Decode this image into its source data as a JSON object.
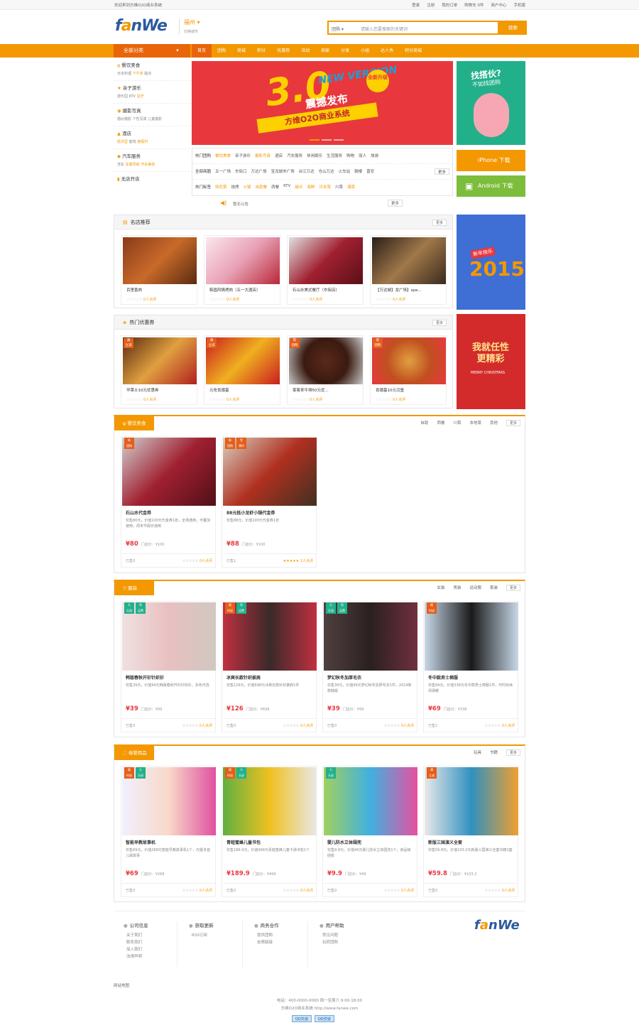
{
  "topbar": {
    "welcome": "欢迎来到方维O2O商业系统",
    "links": [
      "登录",
      "注册",
      "我的订单",
      "购物车 0件",
      "商户中心",
      "手机版"
    ]
  },
  "header": {
    "logo_text": "fanWe",
    "city": "福州",
    "city_switch": "切换城市",
    "search_select": "团购",
    "search_placeholder": "请输入您要搜索的关键词",
    "search_button": "搜索"
  },
  "nav": {
    "all_label": "全部分类",
    "items": [
      "首页",
      "团购",
      "商城",
      "积分",
      "优惠券",
      "活动",
      "商家",
      "分享",
      "小组",
      "达人秀",
      "积分商城"
    ]
  },
  "categories": [
    {
      "title": "餐饮美食",
      "subs": [
        "日本料理",
        "下午茶",
        "甜点"
      ]
    },
    {
      "title": "亲子游乐",
      "subs": [
        "游乐园",
        "KTV",
        "足疗"
      ]
    },
    {
      "title": "摄影写真",
      "subs": [
        "婚纱摄影",
        "个性写真",
        "儿童摄影"
      ]
    },
    {
      "title": "酒店",
      "subs": [
        "经济型",
        "客栈",
        "度假村"
      ]
    },
    {
      "title": "汽车服务",
      "subs": [
        "洗车",
        "车载导航",
        "汽车美容"
      ]
    },
    {
      "title": "无店开店",
      "subs": []
    }
  ],
  "banner": {
    "big": "3.0",
    "new": "NEW VERSION",
    "badge": "全新升级",
    "headline": "震撼发布",
    "ribbon": "方维O2O商业系统"
  },
  "side_ad": {
    "line1": "找搭伙?",
    "line2": "不如找团购"
  },
  "apps": {
    "ios": "iPhone 下载",
    "android": "Android 下载"
  },
  "hot": {
    "row1": [
      "热门团购",
      "餐饮美食",
      "亲子游乐",
      "摄影写真",
      "酒店",
      "汽车服务",
      "休闲娱乐",
      "生活服务",
      "购物",
      "丽人",
      "旅游"
    ],
    "row2": [
      "全部商圈",
      "五一广场",
      "东街口",
      "万达广场",
      "宝龙城市广场",
      "台江万达",
      "仓山万达",
      "火车站",
      "鼓楼",
      "晋安"
    ],
    "row3": [
      "热门标签",
      "特色菜",
      "烧烤",
      "火锅",
      "自助餐",
      "西餐",
      "KTV",
      "甜点",
      "海鲜",
      "日本菜",
      "川菜",
      "湘菜"
    ],
    "more": "更多"
  },
  "notice": {
    "text": "暂无公告",
    "more": "更多"
  },
  "stores": {
    "title": "名店推荐",
    "more": "更多",
    "items": [
      {
        "name": "百里香肉",
        "count": "0人点评"
      },
      {
        "name": "韩国风情烤肉（五一大酒店）",
        "count": "0人点评"
      },
      {
        "name": "石山水美式餐厅（东街店）",
        "count": "0人点评"
      },
      {
        "name": "【万达城】龙广场】spa...",
        "count": "0人点评"
      }
    ]
  },
  "coupons": {
    "title": "热门优惠券",
    "more": "更多",
    "items": [
      {
        "name": "华莱士10元优惠券",
        "count": "0人点评"
      },
      {
        "name": "元吃肯德基",
        "count": "0人点评"
      },
      {
        "name": "豪客来牛排50元优...",
        "count": "0人点评"
      },
      {
        "name": "肯德基10元汉堡",
        "count": "0人点评"
      }
    ]
  },
  "promo2": {
    "text": "2015",
    "tag": "新年快乐"
  },
  "promo3": {
    "text": "我就任性 更精彩",
    "tag": "MERRY CHRISTMAS"
  },
  "sections": [
    {
      "title": "餐饮美食",
      "subs": [
        "自助",
        "西餐",
        "川菜",
        "本地菜",
        "其他"
      ],
      "more": "更多",
      "deals": [
        {
          "name": "石山水代金券",
          "desc": "仅售80元，价值100元代金券1张，全场通用，可叠加使用，周末节假日通用",
          "price": "¥80",
          "orig": "门店价：¥100",
          "sold": "已售0",
          "rate": "0人点评"
        },
        {
          "name": "88元抵小龙虾小锅代金券",
          "desc": "仅售88元，价值100元代金券1张",
          "price": "¥88",
          "orig": "门店价：¥100",
          "sold": "已售1",
          "rate": "1人点评"
        }
      ]
    },
    {
      "title": "服装",
      "subs": [
        "女装",
        "男装",
        "运动服",
        "套装"
      ],
      "more": "更多",
      "deals": [
        {
          "name": "韩版春秋开衫针织衫",
          "desc": "仅售39元，价值99元韩版春秋开衫针织衫，多色可选",
          "price": "¥39",
          "orig": "门店价：¥99",
          "sold": "已售0",
          "rate": "0人点评"
        },
        {
          "name": "冰爽长款针织披肩",
          "desc": "仅售126元，价值698元冰爽长款针织披肩1件",
          "price": "¥126",
          "orig": "门店价：¥698",
          "sold": "已售0",
          "rate": "0人点评"
        },
        {
          "name": "梦幻秋冬加厚毛衣",
          "desc": "仅售39元，价值99元梦幻秋冬加厚毛衣1件，2014新款韩版",
          "price": "¥39",
          "orig": "门店价：¥99",
          "sold": "已售0",
          "rate": "0人点评"
        },
        {
          "name": "冬中款男士棉服",
          "desc": "仅售69元，价值338元冬中款男士棉服1件，可时尚休闲保暖",
          "price": "¥69",
          "orig": "门店价：¥338",
          "sold": "已售1",
          "rate": "0人点评"
        }
      ]
    },
    {
      "title": "母婴用品",
      "subs": [
        "玩具",
        "书籍"
      ],
      "more": "更多",
      "deals": [
        {
          "name": "智能早教故事机",
          "desc": "仅售69元，价值268元智能早教故事机1个，内置多首儿歌故事",
          "price": "¥69",
          "orig": "门店价：¥268",
          "sold": "已售0",
          "rate": "0人点评"
        },
        {
          "name": "青蛙蜜蜂儿童书包",
          "desc": "仅售189.9元，价值499元青蛙蜜蜂儿童卡通书包1个",
          "price": "¥189.9",
          "orig": "门店价：¥499",
          "sold": "已售0",
          "rate": "0人点评"
        },
        {
          "name": "婴儿防水立体围兜",
          "desc": "仅售9.9元，价值49元婴儿防水立体围兜1个，食品级硅胶",
          "price": "¥9.9",
          "orig": "门店价：¥49",
          "sold": "已售0",
          "rate": "0人点评"
        },
        {
          "name": "新版三国演义全套",
          "desc": "仅售59.8元，价值103.2元新版三国演义全套书籍1套",
          "price": "¥59.8",
          "orig": "门店价：¥103.2",
          "sold": "已售0",
          "rate": "0人点评"
        }
      ]
    }
  ],
  "footer": {
    "cols": [
      {
        "title": "公司信息",
        "items": [
          "关于我们",
          "联系我们",
          "加入我们",
          "法律声明"
        ]
      },
      {
        "title": "获取更新",
        "items": [
          "RSS订阅"
        ]
      },
      {
        "title": "商务合作",
        "items": [
          "提供团购",
          "友情链接"
        ]
      },
      {
        "title": "用户帮助",
        "items": [
          "常见问题",
          "玩转团购"
        ]
      }
    ],
    "friend": "网站地图",
    "copy1": "电话：400-0000-0000 周一至周六 9:00-18:00",
    "copy2": "方维O2O商业系统 http://www.fanwe.com",
    "qq1": "QQ交谈",
    "qq2": "QQ交谈"
  }
}
